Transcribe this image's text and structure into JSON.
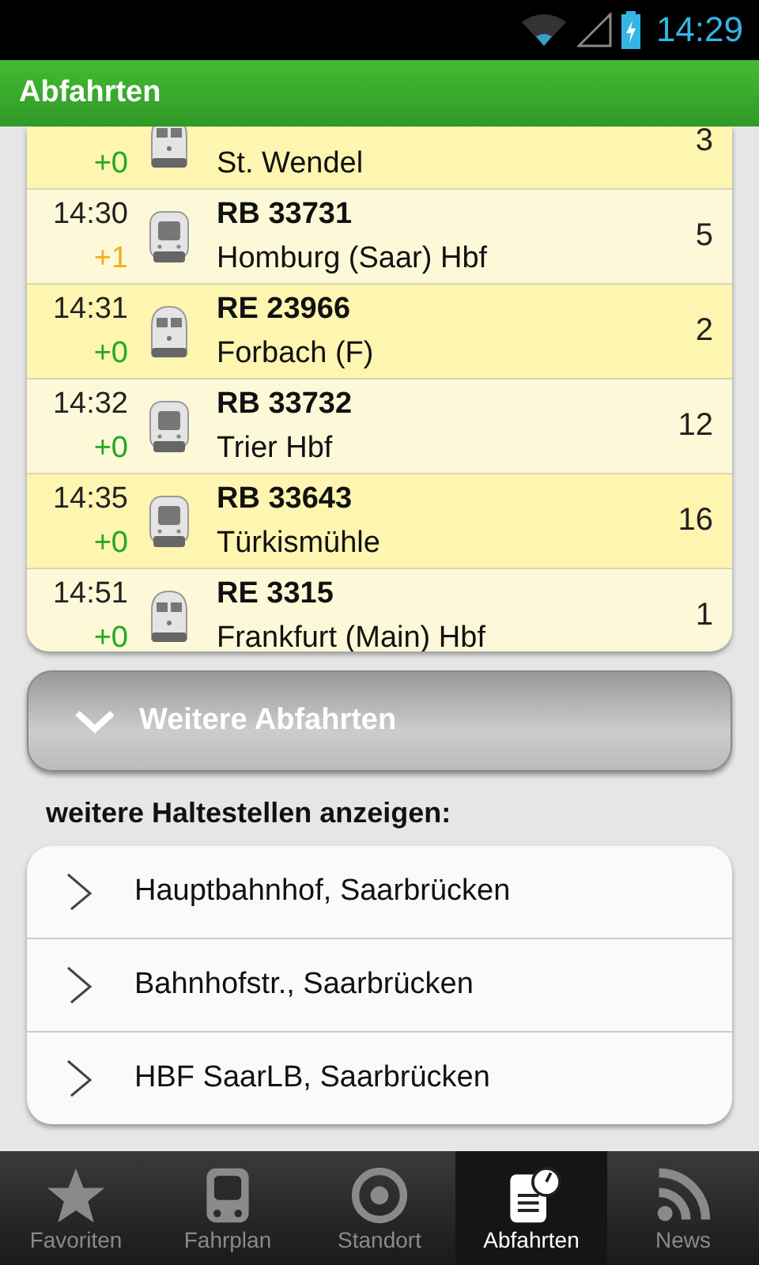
{
  "status_bar": {
    "time": "14:29"
  },
  "header": {
    "title": "Abfahrten"
  },
  "departures": [
    {
      "delay": "+0",
      "color": "#22aa22",
      "kind": "re",
      "destination": "St. Wendel",
      "platform": "3"
    },
    {
      "time": "14:30",
      "delay": "+1",
      "color": "#f0b020",
      "kind": "rb",
      "line": "RB 33731",
      "destination": "Homburg (Saar) Hbf",
      "platform": "5"
    },
    {
      "time": "14:31",
      "delay": "+0",
      "color": "#22aa22",
      "kind": "re",
      "line": "RE 23966",
      "destination": "Forbach (F)",
      "platform": "2"
    },
    {
      "time": "14:32",
      "delay": "+0",
      "color": "#22aa22",
      "kind": "rb",
      "line": "RB 33732",
      "destination": "Trier Hbf",
      "platform": "12"
    },
    {
      "time": "14:35",
      "delay": "+0",
      "color": "#22aa22",
      "kind": "rb",
      "line": "RB 33643",
      "destination": "Türkismühle",
      "platform": "16"
    },
    {
      "time": "14:51",
      "delay": "+0",
      "color": "#22aa22",
      "kind": "re",
      "line": "RE 3315",
      "destination": "Frankfurt (Main) Hbf",
      "platform": "1"
    }
  ],
  "more_button": {
    "label": "Weitere Abfahrten"
  },
  "stops_heading": "weitere Haltestellen anzeigen:",
  "stops": [
    "Hauptbahnhof, Saarbrücken",
    "Bahnhofstr., Saarbrücken",
    "HBF SaarLB, Saarbrücken"
  ],
  "tabs": [
    {
      "label": "Favoriten",
      "kind": "star",
      "selected": false
    },
    {
      "label": "Fahrplan",
      "kind": "train",
      "selected": false
    },
    {
      "label": "Standort",
      "kind": "target",
      "selected": false
    },
    {
      "label": "Abfahrten",
      "kind": "departures",
      "selected": true
    },
    {
      "label": "News",
      "kind": "rss",
      "selected": false
    }
  ]
}
